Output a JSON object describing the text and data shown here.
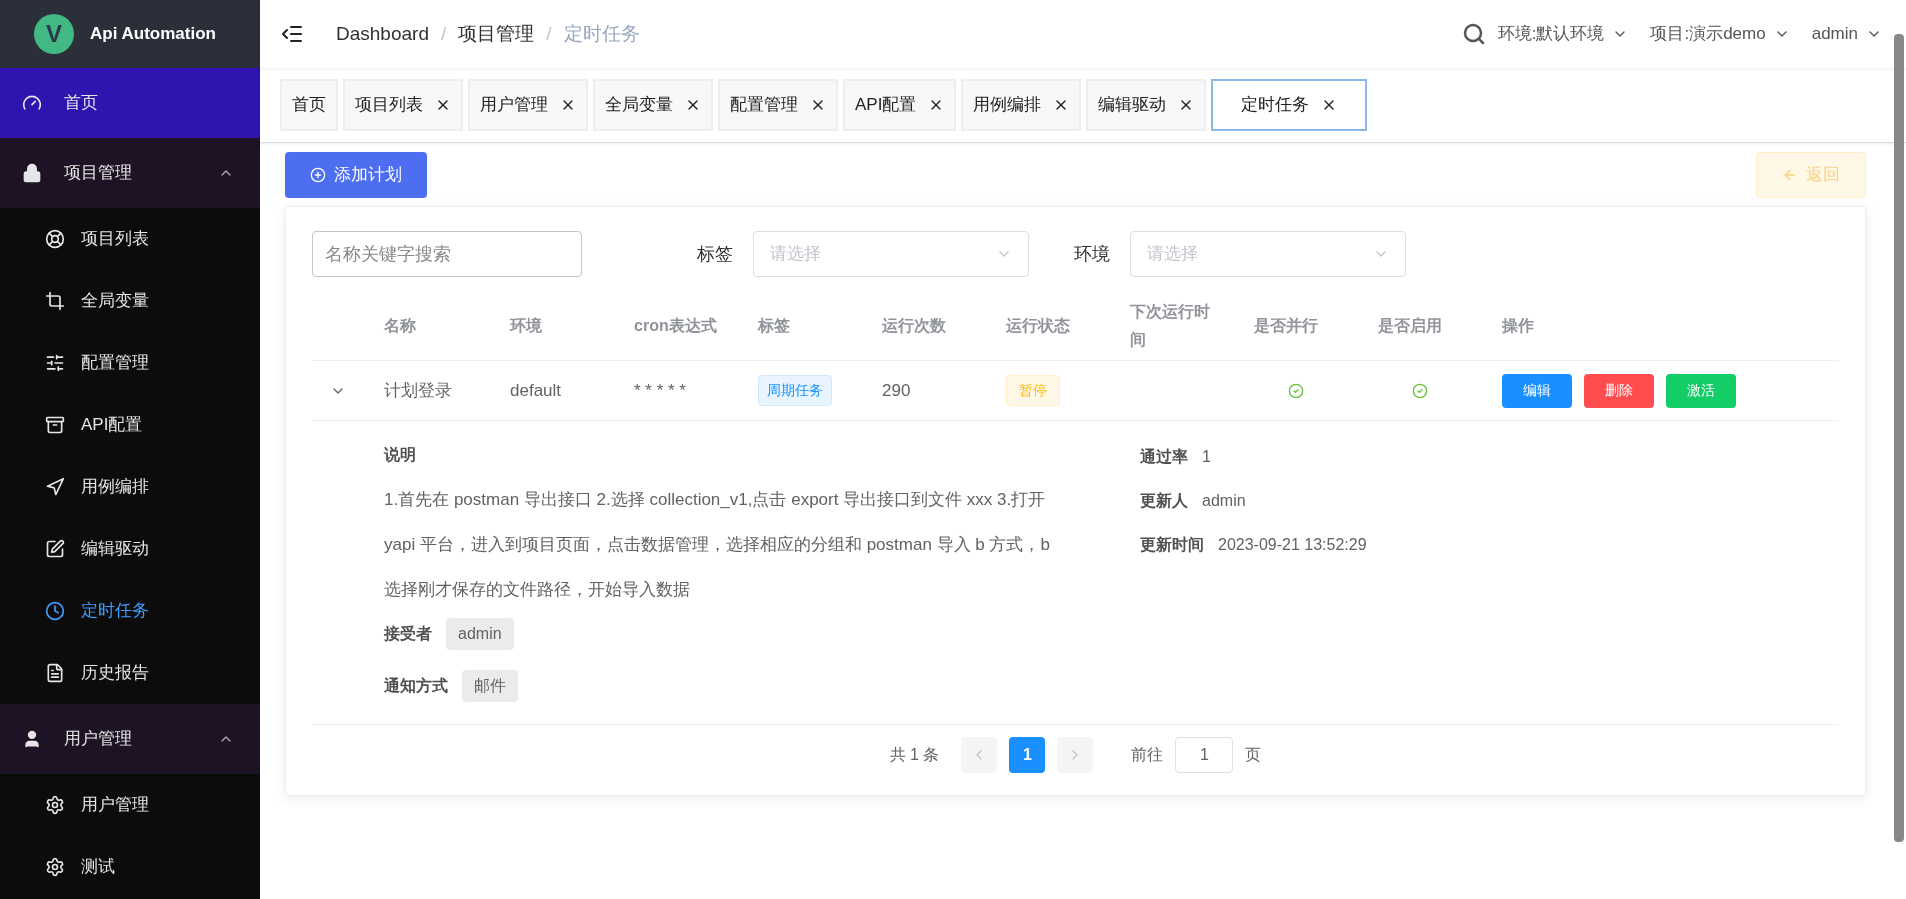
{
  "sidebar": {
    "logo_letter": "V",
    "title": "Api Automation",
    "items": [
      {
        "kind": "item",
        "label": "首页",
        "selected": false,
        "highlight": true
      },
      {
        "kind": "group",
        "label": "项目管理",
        "expanded": true,
        "children": [
          {
            "label": "项目列表",
            "selected": false
          },
          {
            "label": "全局变量",
            "selected": false
          },
          {
            "label": "配置管理",
            "selected": false
          },
          {
            "label": "API配置",
            "selected": false
          },
          {
            "label": "用例编排",
            "selected": false
          },
          {
            "label": "编辑驱动",
            "selected": false
          },
          {
            "label": "定时任务",
            "selected": true
          },
          {
            "label": "历史报告",
            "selected": false
          }
        ]
      },
      {
        "kind": "group",
        "label": "用户管理",
        "expanded": true,
        "children": [
          {
            "label": "用户管理",
            "selected": false
          },
          {
            "label": "测试",
            "selected": false
          }
        ]
      }
    ]
  },
  "header": {
    "breadcrumb": [
      "Dashboard",
      "项目管理",
      "定时任务"
    ],
    "separator": "/",
    "env": "环境:默认环境",
    "project": "项目:演示demo",
    "user": "admin"
  },
  "tabs": [
    {
      "label": "首页",
      "closable": false,
      "selected": false
    },
    {
      "label": "项目列表",
      "closable": true,
      "selected": false
    },
    {
      "label": "用户管理",
      "closable": true,
      "selected": false
    },
    {
      "label": "全局变量",
      "closable": true,
      "selected": false
    },
    {
      "label": "配置管理",
      "closable": true,
      "selected": false
    },
    {
      "label": "API配置",
      "closable": true,
      "selected": false
    },
    {
      "label": "用例编排",
      "closable": true,
      "selected": false
    },
    {
      "label": "编辑驱动",
      "closable": true,
      "selected": false
    },
    {
      "label": "定时任务",
      "closable": true,
      "selected": true
    }
  ],
  "toolbar": {
    "add_button": "添加计划",
    "back_button": "返回",
    "back_disabled": true
  },
  "filters": {
    "search_placeholder": "名称关键字搜索",
    "tag_label": "标签",
    "tag_placeholder": "请选择",
    "env_label": "环境",
    "env_placeholder": "请选择"
  },
  "table": {
    "columns": [
      "名称",
      "环境",
      "cron表达式",
      "标签",
      "运行次数",
      "运行状态",
      "下次运行时间",
      "是否并行",
      "是否启用",
      "操作"
    ],
    "rows": [
      {
        "expanded": true,
        "name": "计划登录",
        "env": "default",
        "cron": "* * * * *",
        "tag": "周期任务",
        "runs": "290",
        "status": "暂停",
        "parallel": true,
        "enabled": true,
        "actions": [
          {
            "label": "编辑",
            "color": "#1890ff"
          },
          {
            "label": "删除",
            "color": "#ff4d4f"
          },
          {
            "label": "激活",
            "color": "#13ce66"
          }
        ],
        "detail": {
          "description_label": "说明",
          "description": "1.首先在 postman 导出接口 2.选择 collection_v1,点击 export 导出接口到文件 xxx 3.打开 yapi 平台，进入到项目页面，点击数据管理，选择相应的分组和 postman 导入 b 方式，b 选择刚才保存的文件路径，开始导入数据",
          "receiver_label": "接受者",
          "receivers": [
            "admin"
          ],
          "notify_label": "通知方式",
          "notify": [
            "邮件"
          ],
          "info": [
            {
              "label": "通过率",
              "value": "1"
            },
            {
              "label": "更新人",
              "value": "admin"
            },
            {
              "label": "更新时间",
              "value": "2023-09-21 13:52:29"
            }
          ]
        }
      }
    ]
  },
  "pagination": {
    "total": "共 1 条",
    "pages": [
      {
        "label": "1",
        "selected": true
      }
    ],
    "goto_label": "前往",
    "goto_value": "1",
    "suffix": "页"
  }
}
